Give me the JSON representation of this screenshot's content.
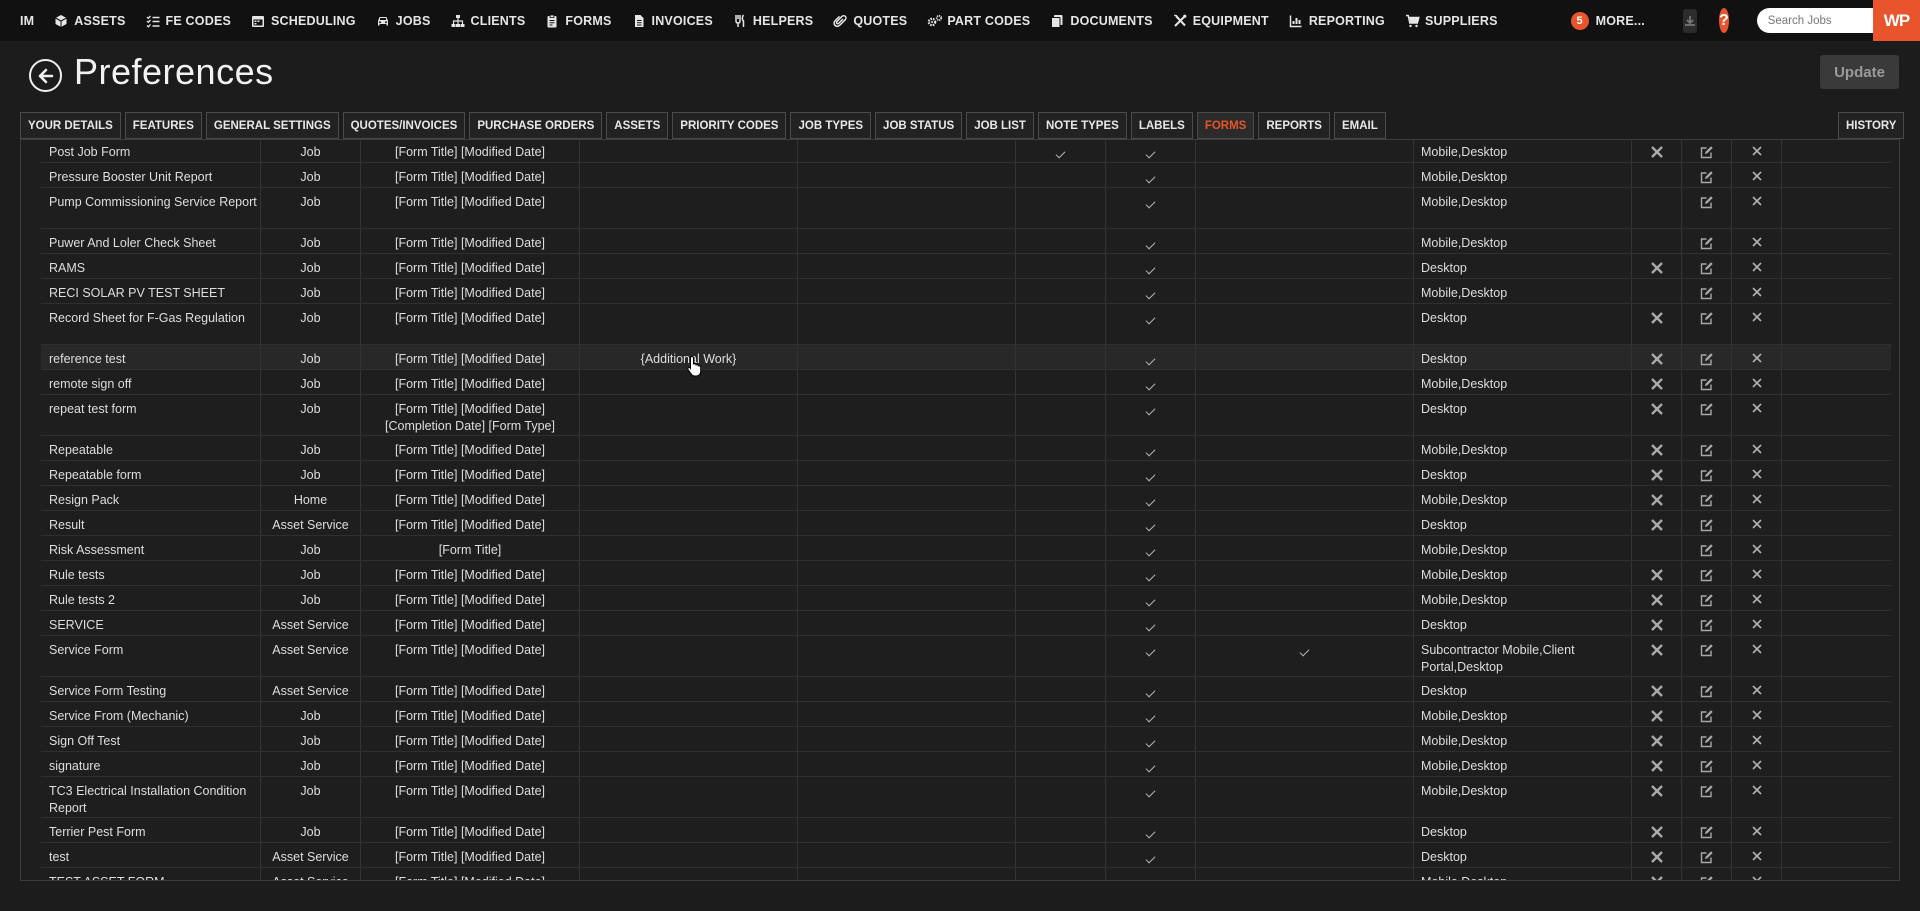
{
  "nav": {
    "items": [
      {
        "label": "IM",
        "icon": "none"
      },
      {
        "label": "ASSETS",
        "icon": "cube-icon"
      },
      {
        "label": "FE CODES",
        "icon": "list-check-icon"
      },
      {
        "label": "SCHEDULING",
        "icon": "calendar-icon"
      },
      {
        "label": "JOBS",
        "icon": "car-icon"
      },
      {
        "label": "CLIENTS",
        "icon": "sitemap-icon"
      },
      {
        "label": "FORMS",
        "icon": "clipboard-icon"
      },
      {
        "label": "INVOICES",
        "icon": "file-icon"
      },
      {
        "label": "HELPERS",
        "icon": "fork-icon"
      },
      {
        "label": "QUOTES",
        "icon": "paperclip-icon"
      },
      {
        "label": "PART CODES",
        "icon": "gears-icon"
      },
      {
        "label": "DOCUMENTS",
        "icon": "copy-icon"
      },
      {
        "label": "EQUIPMENT",
        "icon": "tools-icon"
      },
      {
        "label": "REPORTING",
        "icon": "bar-chart-icon"
      },
      {
        "label": "SUPPLIERS",
        "icon": "cart-icon"
      }
    ],
    "more_count": "5",
    "more_label": "MORE...",
    "help_label": "?",
    "search_placeholder": "Search Jobs",
    "logo_text": "WP"
  },
  "header": {
    "title": "Preferences",
    "update_label": "Update"
  },
  "tabs": [
    {
      "label": "YOUR DETAILS",
      "active": false
    },
    {
      "label": "FEATURES",
      "active": false
    },
    {
      "label": "GENERAL SETTINGS",
      "active": false
    },
    {
      "label": "QUOTES/INVOICES",
      "active": false
    },
    {
      "label": "PURCHASE ORDERS",
      "active": false
    },
    {
      "label": "ASSETS",
      "active": false
    },
    {
      "label": "PRIORITY CODES",
      "active": false
    },
    {
      "label": "JOB TYPES",
      "active": false
    },
    {
      "label": "JOB STATUS",
      "active": false
    },
    {
      "label": "JOB LIST",
      "active": false
    },
    {
      "label": "NOTE TYPES",
      "active": false
    },
    {
      "label": "LABELS",
      "active": false
    },
    {
      "label": "FORMS",
      "active": true
    },
    {
      "label": "REPORTS",
      "active": false
    },
    {
      "label": "EMAIL",
      "active": false
    }
  ],
  "history_label": "HISTORY",
  "accent_color": "#e8542b",
  "forms": [
    {
      "name": "Post Job Form",
      "type": "Job",
      "title_format": "[Form Title] [Modified Date]",
      "extra": "",
      "check_a": true,
      "check_b": true,
      "check_c": false,
      "platforms": "Mobile,Desktop",
      "reset_icon": true
    },
    {
      "name": "Pressure Booster Unit Report",
      "type": "Job",
      "title_format": "[Form Title] [Modified Date]",
      "extra": "",
      "check_a": false,
      "check_b": true,
      "check_c": false,
      "platforms": "Mobile,Desktop",
      "reset_icon": false
    },
    {
      "name": "Pump Commissioning Service Report",
      "type": "Job",
      "title_format": "[Form Title] [Modified Date]",
      "extra": "",
      "check_a": false,
      "check_b": true,
      "check_c": false,
      "platforms": "Mobile,Desktop",
      "reset_icon": false
    },
    {
      "name": "Puwer And Loler Check Sheet",
      "type": "Job",
      "title_format": "[Form Title] [Modified Date]",
      "extra": "",
      "check_a": false,
      "check_b": true,
      "check_c": false,
      "platforms": "Mobile,Desktop",
      "reset_icon": false
    },
    {
      "name": "RAMS",
      "type": "Job",
      "title_format": "[Form Title] [Modified Date]",
      "extra": "",
      "check_a": false,
      "check_b": true,
      "check_c": false,
      "platforms": "Desktop",
      "reset_icon": true
    },
    {
      "name": "RECI SOLAR PV TEST SHEET",
      "type": "Job",
      "title_format": "[Form Title] [Modified Date]",
      "extra": "",
      "check_a": false,
      "check_b": true,
      "check_c": false,
      "platforms": "Mobile,Desktop",
      "reset_icon": false
    },
    {
      "name": "Record Sheet for F-Gas Regulation",
      "type": "Job",
      "title_format": "[Form Title] [Modified Date]",
      "extra": "",
      "check_a": false,
      "check_b": true,
      "check_c": false,
      "platforms": "Desktop",
      "reset_icon": true
    },
    {
      "name": "reference test",
      "type": "Job",
      "title_format": "[Form Title] [Modified Date]",
      "extra": "{Additional Work}",
      "check_a": false,
      "check_b": true,
      "check_c": false,
      "platforms": "Desktop",
      "reset_icon": true
    },
    {
      "name": "remote sign off",
      "type": "Job",
      "title_format": "[Form Title] [Modified Date]",
      "extra": "",
      "check_a": false,
      "check_b": true,
      "check_c": false,
      "platforms": "Mobile,Desktop",
      "reset_icon": true
    },
    {
      "name": "repeat test form",
      "type": "Job",
      "title_format": "[Form Title] [Modified Date] [Completion Date] [Form Type]",
      "extra": "",
      "check_a": false,
      "check_b": true,
      "check_c": false,
      "platforms": "Desktop",
      "reset_icon": true
    },
    {
      "name": "Repeatable",
      "type": "Job",
      "title_format": "[Form Title] [Modified Date]",
      "extra": "",
      "check_a": false,
      "check_b": true,
      "check_c": false,
      "platforms": "Mobile,Desktop",
      "reset_icon": true
    },
    {
      "name": "Repeatable form",
      "type": "Job",
      "title_format": "[Form Title] [Modified Date]",
      "extra": "",
      "check_a": false,
      "check_b": true,
      "check_c": false,
      "platforms": "Desktop",
      "reset_icon": true
    },
    {
      "name": "Resign Pack",
      "type": "Home",
      "title_format": "[Form Title] [Modified Date]",
      "extra": "",
      "check_a": false,
      "check_b": true,
      "check_c": false,
      "platforms": "Mobile,Desktop",
      "reset_icon": true
    },
    {
      "name": "Result",
      "type": "Asset Service",
      "title_format": "[Form Title] [Modified Date]",
      "extra": "",
      "check_a": false,
      "check_b": true,
      "check_c": false,
      "platforms": "Desktop",
      "reset_icon": true
    },
    {
      "name": "Risk Assessment",
      "type": "Job",
      "title_format": "[Form Title]",
      "extra": "",
      "check_a": false,
      "check_b": true,
      "check_c": false,
      "platforms": "Mobile,Desktop",
      "reset_icon": false
    },
    {
      "name": "Rule tests",
      "type": "Job",
      "title_format": "[Form Title] [Modified Date]",
      "extra": "",
      "check_a": false,
      "check_b": true,
      "check_c": false,
      "platforms": "Mobile,Desktop",
      "reset_icon": true
    },
    {
      "name": "Rule tests 2",
      "type": "Job",
      "title_format": "[Form Title] [Modified Date]",
      "extra": "",
      "check_a": false,
      "check_b": true,
      "check_c": false,
      "platforms": "Mobile,Desktop",
      "reset_icon": true
    },
    {
      "name": "SERVICE",
      "type": "Asset Service",
      "title_format": "[Form Title] [Modified Date]",
      "extra": "",
      "check_a": false,
      "check_b": true,
      "check_c": false,
      "platforms": "Desktop",
      "reset_icon": true
    },
    {
      "name": "Service Form",
      "type": "Asset Service",
      "title_format": "[Form Title] [Modified Date]",
      "extra": "",
      "check_a": false,
      "check_b": true,
      "check_c": true,
      "platforms": "Subcontractor Mobile,Client Portal,Desktop",
      "reset_icon": true
    },
    {
      "name": "Service Form Testing",
      "type": "Asset Service",
      "title_format": "[Form Title] [Modified Date]",
      "extra": "",
      "check_a": false,
      "check_b": true,
      "check_c": false,
      "platforms": "Desktop",
      "reset_icon": true
    },
    {
      "name": "Service From (Mechanic)",
      "type": "Job",
      "title_format": "[Form Title] [Modified Date]",
      "extra": "",
      "check_a": false,
      "check_b": true,
      "check_c": false,
      "platforms": "Mobile,Desktop",
      "reset_icon": true
    },
    {
      "name": "Sign Off Test",
      "type": "Job",
      "title_format": "[Form Title] [Modified Date]",
      "extra": "",
      "check_a": false,
      "check_b": true,
      "check_c": false,
      "platforms": "Mobile,Desktop",
      "reset_icon": true
    },
    {
      "name": "signature",
      "type": "Job",
      "title_format": "[Form Title] [Modified Date]",
      "extra": "",
      "check_a": false,
      "check_b": true,
      "check_c": false,
      "platforms": "Mobile,Desktop",
      "reset_icon": true
    },
    {
      "name": "TC3 Electrical Installation Condition Report",
      "type": "Job",
      "title_format": "[Form Title] [Modified Date]",
      "extra": "",
      "check_a": false,
      "check_b": true,
      "check_c": false,
      "platforms": "Mobile,Desktop",
      "reset_icon": true
    },
    {
      "name": "Terrier Pest Form",
      "type": "Job",
      "title_format": "[Form Title] [Modified Date]",
      "extra": "",
      "check_a": false,
      "check_b": true,
      "check_c": false,
      "platforms": "Desktop",
      "reset_icon": true
    },
    {
      "name": "test",
      "type": "Asset Service",
      "title_format": "[Form Title] [Modified Date]",
      "extra": "",
      "check_a": false,
      "check_b": true,
      "check_c": false,
      "platforms": "Desktop",
      "reset_icon": true
    },
    {
      "name": "TEST ASSET FORM",
      "type": "Asset Service",
      "title_format": "[Form Title] [Modified Date]",
      "extra": "",
      "check_a": false,
      "check_b": true,
      "check_c": false,
      "platforms": "Mobile,Desktop",
      "reset_icon": true
    }
  ]
}
